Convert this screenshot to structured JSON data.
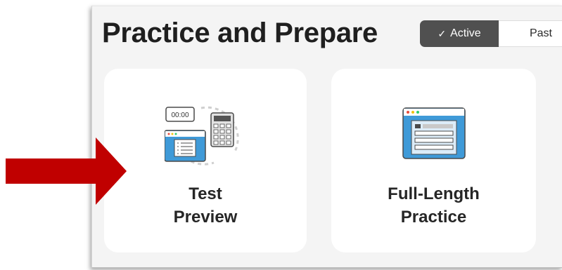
{
  "page": {
    "title": "Practice and Prepare"
  },
  "filter_toggle": {
    "active_label": "Active",
    "inactive_label": "Past",
    "active_icon": "check-icon"
  },
  "cards": [
    {
      "label_line1": "Test",
      "label_line2": "Preview",
      "icon": "test-preview-icon"
    },
    {
      "label_line1": "Full-Length",
      "label_line2": "Practice",
      "icon": "full-length-practice-icon"
    }
  ],
  "timer_icon_text": "00:00",
  "annotation": {
    "arrow_color": "#c00000"
  },
  "colors": {
    "toggle_active_bg": "#505050",
    "icon_blue": "#3f9ad8",
    "icon_light_blue": "#dcecf8",
    "icon_dark": "#4a4a4a"
  }
}
